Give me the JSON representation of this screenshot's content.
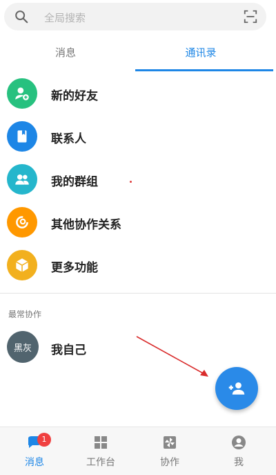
{
  "search": {
    "placeholder": "全局搜索",
    "icon": "search-icon",
    "scan_icon": "scan-icon"
  },
  "tabs": [
    {
      "label": "消息",
      "active": false
    },
    {
      "label": "通讯录",
      "active": true
    }
  ],
  "colors": {
    "accent": "#1d86e6",
    "new_friend": "#27c17f",
    "contacts": "#1d86e6",
    "groups": "#25b6cc",
    "collab": "#ff9800",
    "more": "#f2b01e",
    "fab": "#2a8ae8",
    "badge": "#f04040"
  },
  "menu": [
    {
      "label": "新的好友",
      "icon": "add-user-icon"
    },
    {
      "label": "联系人",
      "icon": "contact-book-icon"
    },
    {
      "label": "我的群组",
      "icon": "group-icon"
    },
    {
      "label": "其他协作关系",
      "icon": "collaboration-icon"
    },
    {
      "label": "更多功能",
      "icon": "box-icon"
    }
  ],
  "recent_section": {
    "title": "最常协作",
    "contacts": [
      {
        "name": "我自己",
        "avatar_text": "黑灰"
      }
    ]
  },
  "fab": {
    "icon": "add-contact-icon"
  },
  "bottom_nav": [
    {
      "label": "消息",
      "icon": "chat-icon",
      "active": true,
      "badge": "1"
    },
    {
      "label": "工作台",
      "icon": "grid-icon",
      "active": false
    },
    {
      "label": "协作",
      "icon": "pinwheel-icon",
      "active": false
    },
    {
      "label": "我",
      "icon": "user-icon",
      "active": false
    }
  ]
}
